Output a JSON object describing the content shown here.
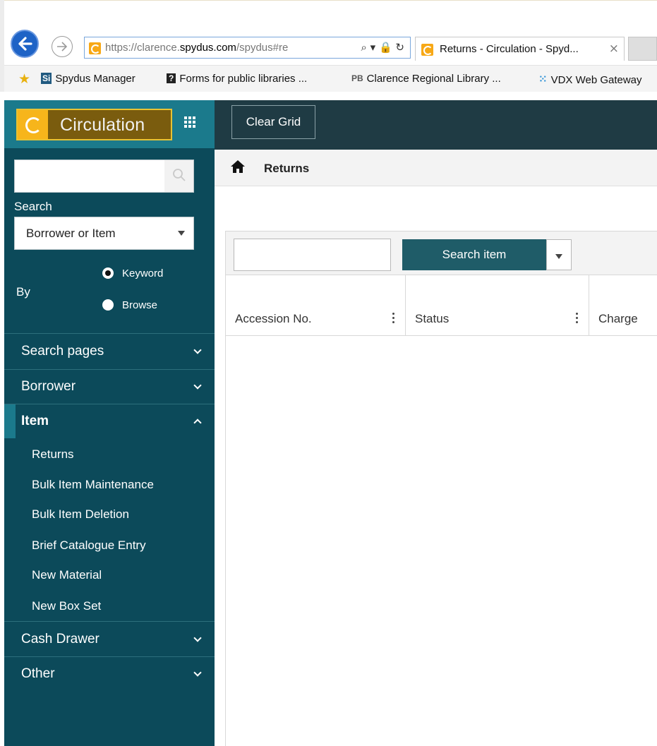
{
  "browser": {
    "url_prefix": "https://clarence.",
    "url_domain": "spydus.com",
    "url_suffix": "/spydus#re",
    "address_icons": "⌕ ▾ 🔒 ↻",
    "tab_title": "Returns - Circulation - Spyd...",
    "tab_close": "×"
  },
  "favorites": [
    {
      "icon": "Si",
      "label": "Spydus Manager"
    },
    {
      "icon": "?",
      "label": "Forms for public libraries ..."
    },
    {
      "icon": "PB",
      "label": "Clarence Regional Library ..."
    },
    {
      "icon": "⁙",
      "label": "VDX Web Gateway"
    }
  ],
  "sidebar": {
    "brand_label": "Circulation",
    "search_label": "Search",
    "search_type": "Borrower or Item",
    "by_label": "By",
    "radio_keyword": "Keyword",
    "radio_browse": "Browse",
    "nav": {
      "search_pages": "Search pages",
      "borrower": "Borrower",
      "item": "Item",
      "item_sub": [
        "Returns",
        "Bulk Item Maintenance",
        "Bulk Item Deletion",
        "Brief Catalogue Entry",
        "New Material",
        "New Box Set"
      ],
      "cash_drawer": "Cash Drawer",
      "other": "Other"
    }
  },
  "main": {
    "clear_grid": "Clear Grid",
    "breadcrumb": "Returns",
    "search_button": "Search item",
    "columns": [
      "Accession No.",
      "Status",
      "Charge"
    ]
  }
}
